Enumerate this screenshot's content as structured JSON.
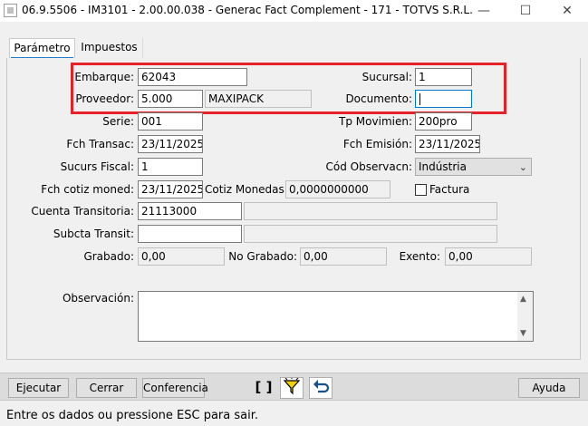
{
  "window": {
    "title": "06.9.5506 - IM3101 - 2.00.00.038 - Generac Fact Complement - 171 - TOTVS S.R.L.",
    "minimize": "—",
    "maximize": "☐",
    "close": "✕"
  },
  "tabs": [
    {
      "label": "Parámetro",
      "active": true
    },
    {
      "label": "Impuestos",
      "active": false
    }
  ],
  "form": {
    "embarque": {
      "label": "Embarque:",
      "value": "62043"
    },
    "sucursal": {
      "label": "Sucursal:",
      "value": "1"
    },
    "proveedor": {
      "label": "Proveedor:",
      "value": "5.000",
      "name": "MAXIPACK"
    },
    "documento": {
      "label": "Documento:",
      "value": ""
    },
    "serie": {
      "label": "Serie:",
      "value": "001"
    },
    "tp_movimien": {
      "label": "Tp Movimien:",
      "value": "200pro"
    },
    "fch_transac": {
      "label": "Fch Transac:",
      "value": "23/11/2025"
    },
    "fch_emision": {
      "label": "Fch Emisión:",
      "value": "23/11/2025"
    },
    "sucurs_fiscal": {
      "label": "Sucurs Fiscal:",
      "value": "1"
    },
    "cod_observacn": {
      "label": "Cód Observacn:",
      "value": "Indústria"
    },
    "fch_cotiz_moned": {
      "label": "Fch cotiz moned:",
      "value": "23/11/2025"
    },
    "cotiz_monedas": {
      "label": "Cotiz Monedas:",
      "value": "0,0000000000"
    },
    "factura": {
      "label": "Factura",
      "checked": false
    },
    "cuenta_transitoria": {
      "label": "Cuenta Transitoria:",
      "value": "21113000",
      "description": ""
    },
    "subcta_transit": {
      "label": "Subcta Transit:",
      "value": "",
      "description": ""
    },
    "grabado": {
      "label": "Grabado:",
      "value": "0,00"
    },
    "no_grabado": {
      "label": "No Grabado:",
      "value": "0,00"
    },
    "exento": {
      "label": "Exento:",
      "value": "0,00"
    },
    "observacion": {
      "label": "Observación:",
      "value": ""
    }
  },
  "toolbar": {
    "ejecutar": "Ejecutar",
    "cerrar": "Cerrar",
    "conferencia": "Conferencia",
    "brackets": "[ ]",
    "ayuda": "Ayuda",
    "icons": [
      "brackets-icon",
      "funnel-icon",
      "undo-icon"
    ]
  },
  "status": "Entre os dados ou pressione ESC para sair.",
  "colors": {
    "highlight_box": "#e52228",
    "tab_accent": "#1c7fd1",
    "focus_border": "#0078d7"
  }
}
